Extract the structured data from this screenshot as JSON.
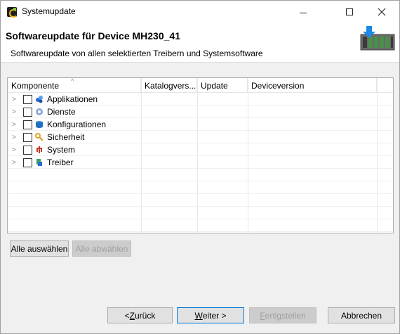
{
  "window": {
    "title": "Systemupdate",
    "controls": {
      "minimize": "—",
      "maximize": "□",
      "close": "✕"
    }
  },
  "banner": {
    "title": "Softwareupdate für Device MH230_41",
    "subtitle": "Softwareupdate von allen selektierten Treibern und Systemsoftware"
  },
  "table": {
    "columns": [
      "Komponente",
      "Katalogvers...",
      "Update",
      "Deviceversion",
      ""
    ],
    "sort_indicator": "^",
    "rows": [
      {
        "label": "Applikationen",
        "icon": "applications-icon",
        "expander": ">"
      },
      {
        "label": "Dienste",
        "icon": "services-gear-icon",
        "expander": ">"
      },
      {
        "label": "Konfigurationen",
        "icon": "configuration-database-icon",
        "expander": ">"
      },
      {
        "label": "Sicherheit",
        "icon": "security-key-icon",
        "expander": ">"
      },
      {
        "label": "System",
        "icon": "system-icon",
        "expander": ">"
      },
      {
        "label": "Treiber",
        "icon": "driver-icon",
        "expander": ">"
      }
    ]
  },
  "selection_buttons": {
    "select_all": "Alle auswählen",
    "deselect_all": "Alle abwählen"
  },
  "nav_buttons": {
    "back_prefix": "< ",
    "back_mnemonic": "Z",
    "back_rest": "urück",
    "next_mnemonic": "W",
    "next_rest": "eiter >",
    "finish_mnemonic": "F",
    "finish_rest": "ertigstellen",
    "cancel": "Abbrechen"
  }
}
